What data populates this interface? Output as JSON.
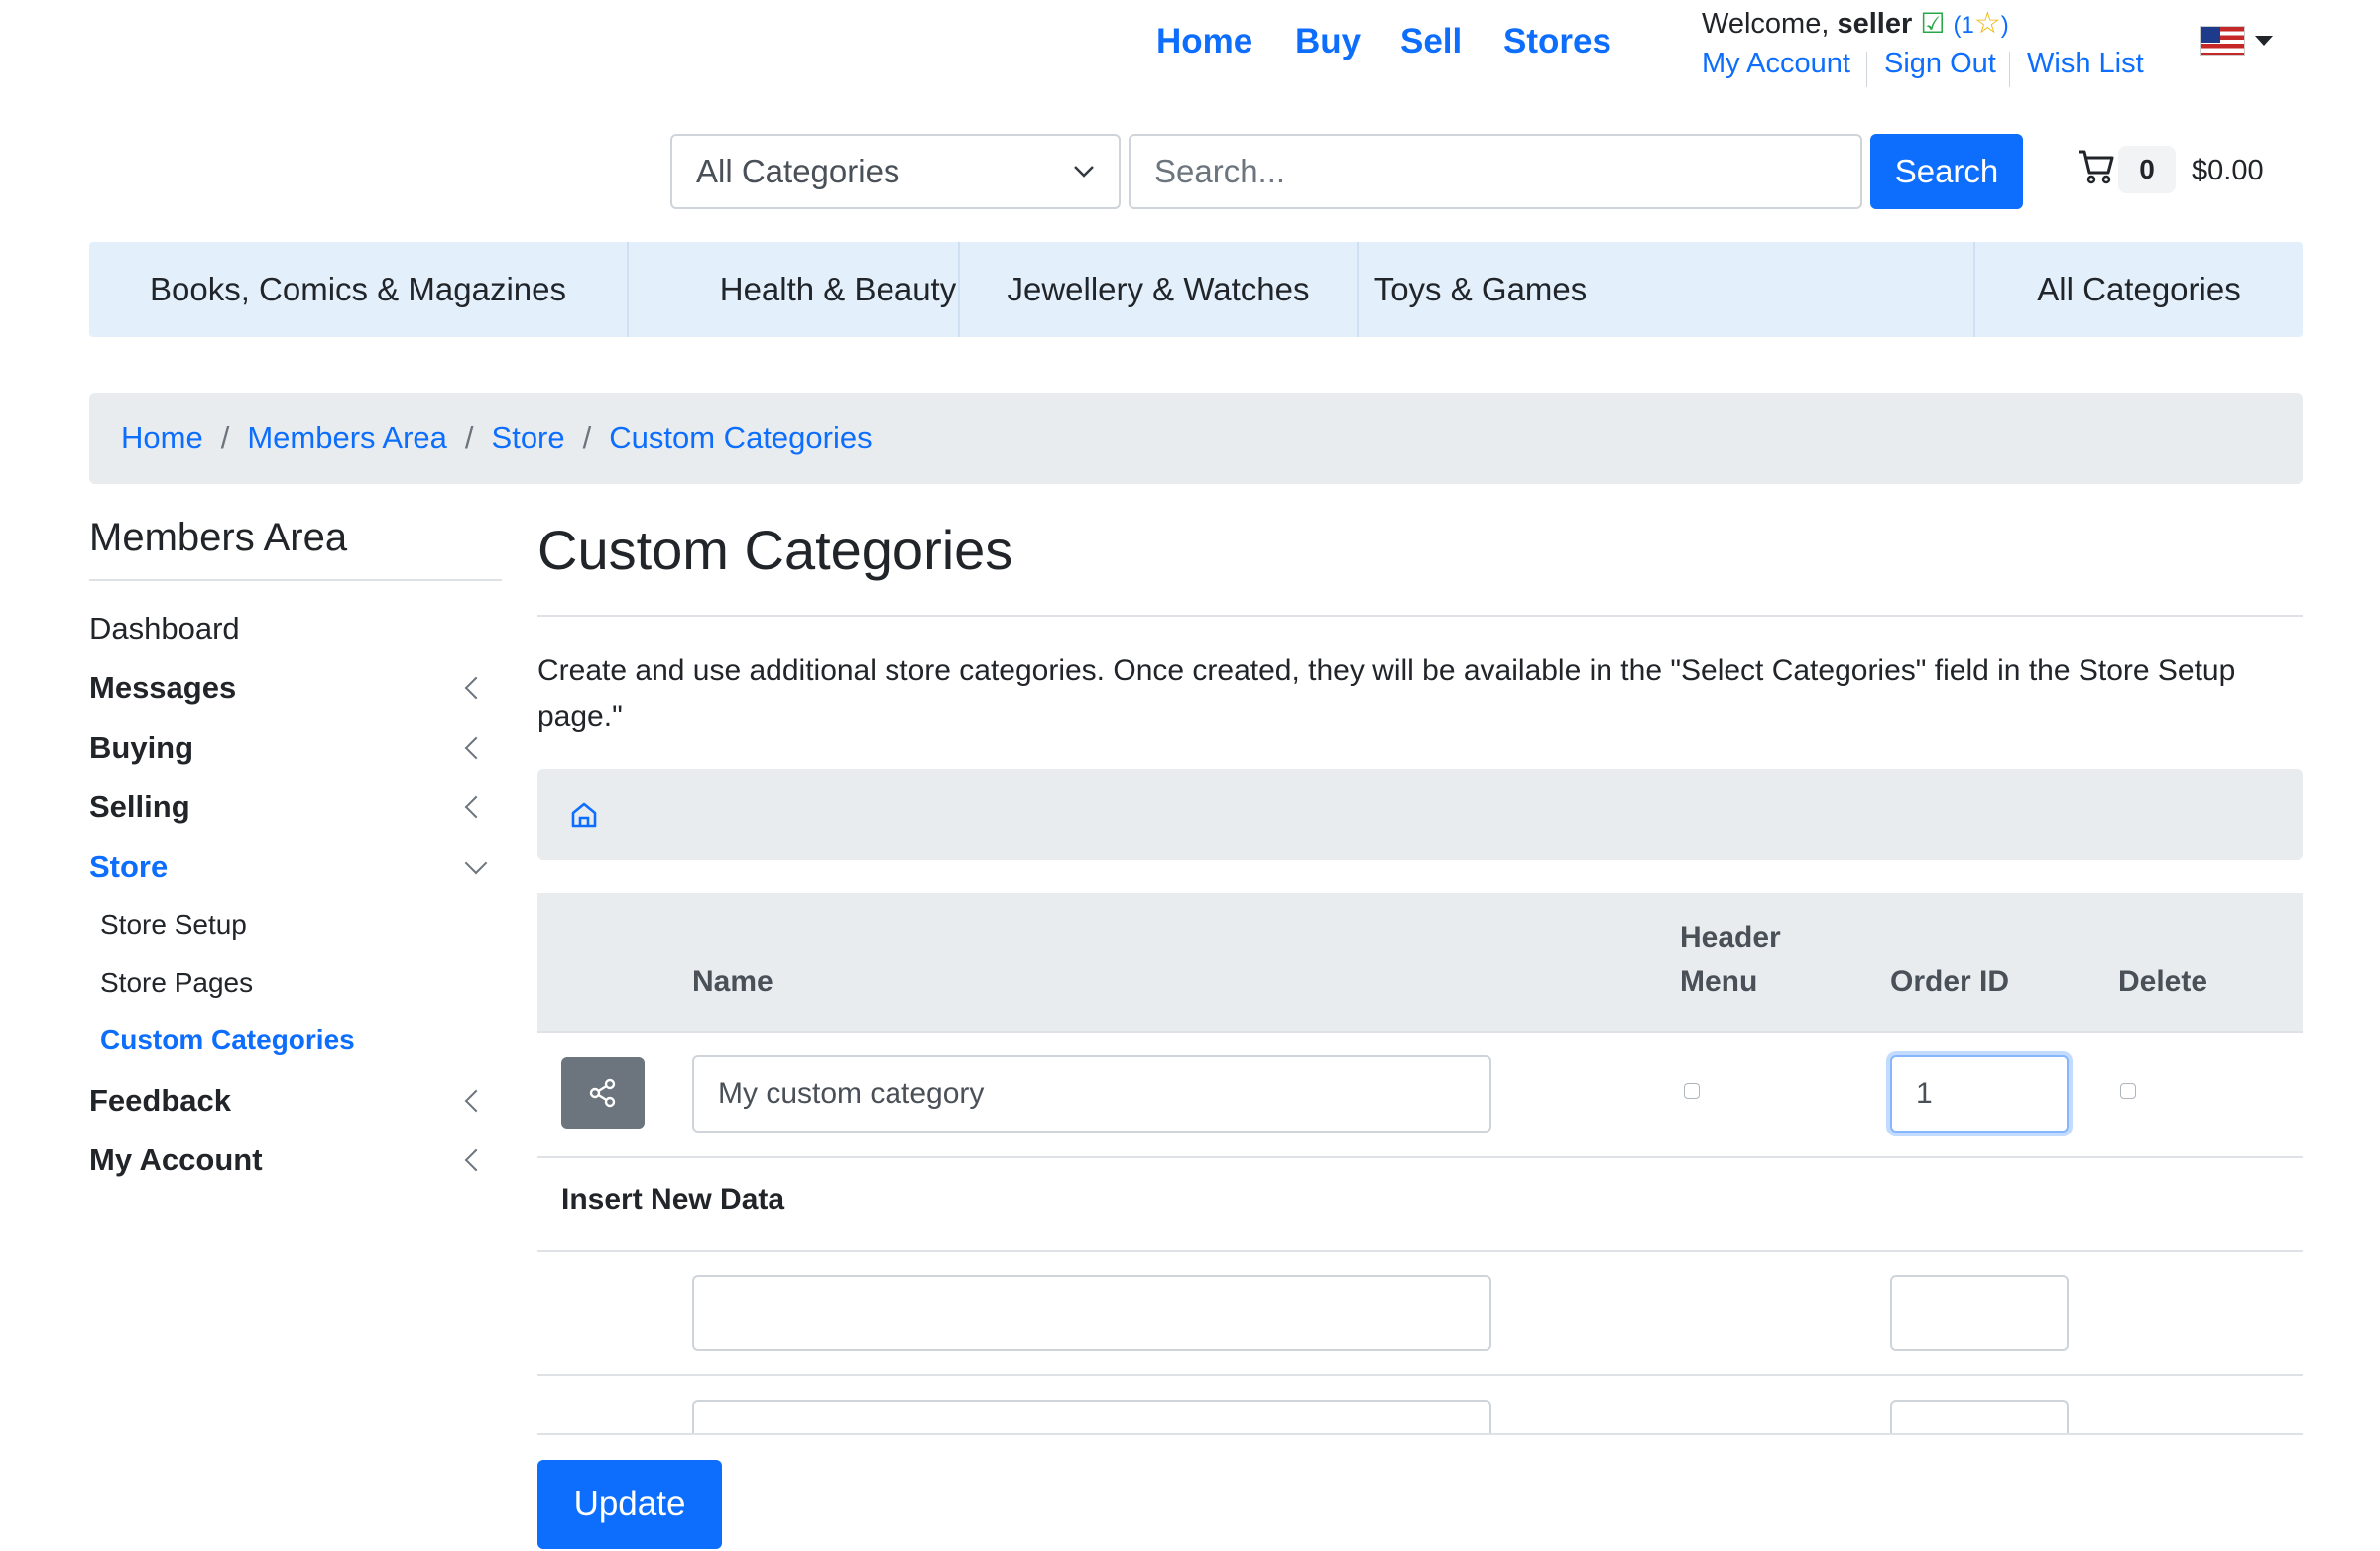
{
  "header": {
    "nav": [
      "Home",
      "Buy",
      "Sell",
      "Stores"
    ],
    "welcome_prefix": "Welcome,",
    "username": "seller",
    "rating_open": "(1",
    "rating_close": ")",
    "account_links": [
      "My Account",
      "Sign Out",
      "Wish List"
    ]
  },
  "search": {
    "category_selected": "All Categories",
    "placeholder": "Search...",
    "button_label": "Search"
  },
  "cart": {
    "count": "0",
    "total": "$0.00"
  },
  "category_bar": [
    "Books, Comics & Magazines",
    "Health & Beauty",
    "Jewellery & Watches",
    "Toys & Games",
    "All Categories"
  ],
  "breadcrumb": [
    "Home",
    "Members Area",
    "Store",
    "Custom Categories"
  ],
  "sidebar": {
    "title": "Members Area",
    "items": [
      "Dashboard",
      "Messages",
      "Buying",
      "Selling",
      "Store",
      "Feedback",
      "My Account"
    ],
    "store_sub": [
      "Store Setup",
      "Store Pages",
      "Custom Categories"
    ]
  },
  "main": {
    "title": "Custom Categories",
    "description": "Create and use additional store categories. Once created, they will be available in the \"Select Categories\" field in the Store Setup page.\"",
    "table": {
      "col_name": "Name",
      "col_header_menu_1": "Header",
      "col_header_menu_2": "Menu",
      "col_order": "Order ID",
      "col_delete": "Delete"
    },
    "rows": [
      {
        "name": "My custom category",
        "order_id": "1",
        "header_menu": false,
        "delete": false
      }
    ],
    "insert_label": "Insert New Data",
    "update_label": "Update"
  },
  "colors": {
    "accent": "#0d6efd",
    "category_bar_bg": "#e3f0fc",
    "breadcrumb_bg": "#e9ecef"
  },
  "icons": [
    "check-icon",
    "star-icon",
    "us-flag-icon",
    "chevron-down-icon",
    "cart-icon",
    "home-icon",
    "share-icon",
    "chevron-left-icon"
  ]
}
